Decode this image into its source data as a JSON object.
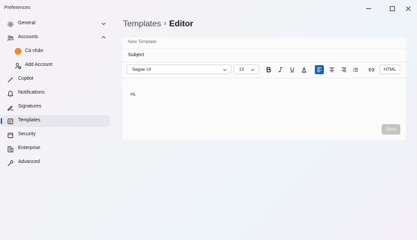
{
  "window": {
    "title": "Preferences"
  },
  "sidebar": {
    "items": [
      {
        "label": "General"
      },
      {
        "label": "Accounts"
      },
      {
        "label": "Cá nhân"
      },
      {
        "label": "Add Account"
      },
      {
        "label": "Copilot"
      },
      {
        "label": "Notifications"
      },
      {
        "label": "Signatures"
      },
      {
        "label": "Templates"
      },
      {
        "label": "Security"
      },
      {
        "label": "Enterprise"
      },
      {
        "label": "Advanced"
      }
    ]
  },
  "breadcrumb": {
    "parent": "Templates",
    "current": "Editor"
  },
  "editor": {
    "name_placeholder": "New Template",
    "subject_placeholder": "Subject",
    "font": "Segoe UI",
    "size": "10",
    "html_label": "HTML",
    "body": "Hi,",
    "save_label": "Save"
  },
  "colors": {
    "accent": "#1760b5",
    "avatar": "#f08a24"
  }
}
